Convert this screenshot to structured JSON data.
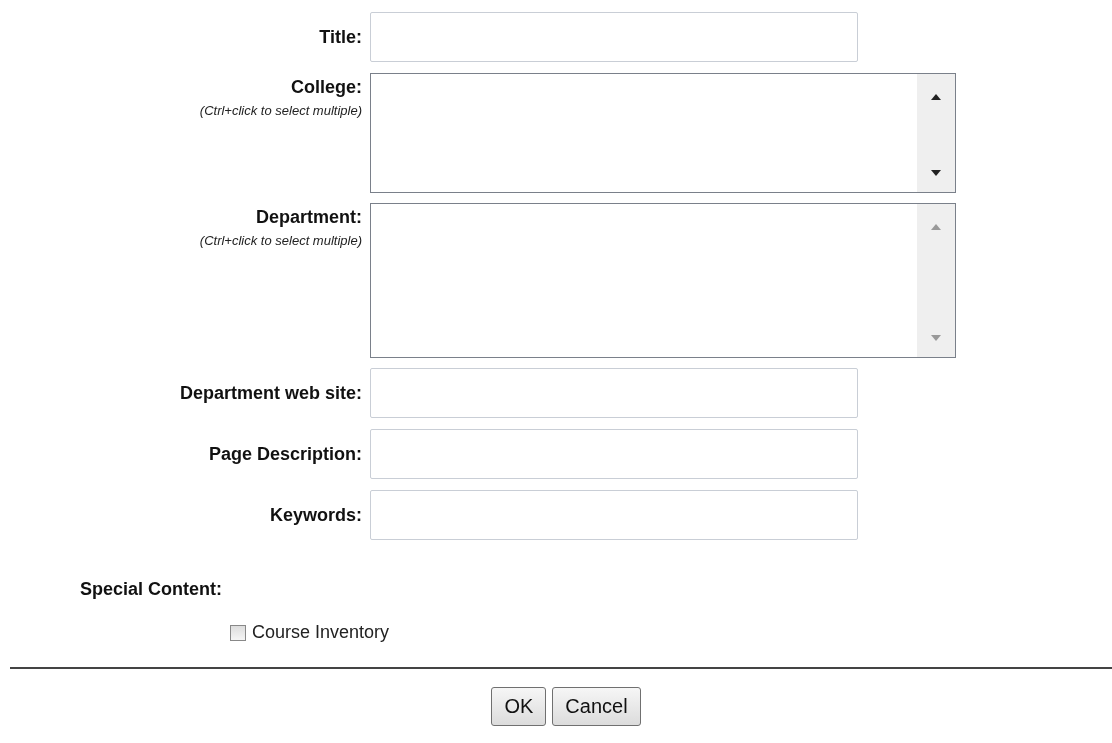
{
  "fields": [
    {
      "kind": "text",
      "label": "Title:"
    },
    {
      "kind": "listbox",
      "label": "College:",
      "hint": "(Ctrl+click to select multiple)",
      "scrollable": true
    },
    {
      "kind": "listbox",
      "label": "Department:",
      "hint": "(Ctrl+click to select multiple)",
      "scrollable": false
    },
    {
      "kind": "text",
      "label": "Department web site:"
    },
    {
      "kind": "text",
      "label": "Page Description:"
    },
    {
      "kind": "text",
      "label": "Keywords:"
    }
  ],
  "special_content": {
    "heading": "Special Content:",
    "options": [
      {
        "label": "Course Inventory",
        "checked": false
      }
    ]
  },
  "buttons": [
    "OK",
    "Cancel"
  ]
}
